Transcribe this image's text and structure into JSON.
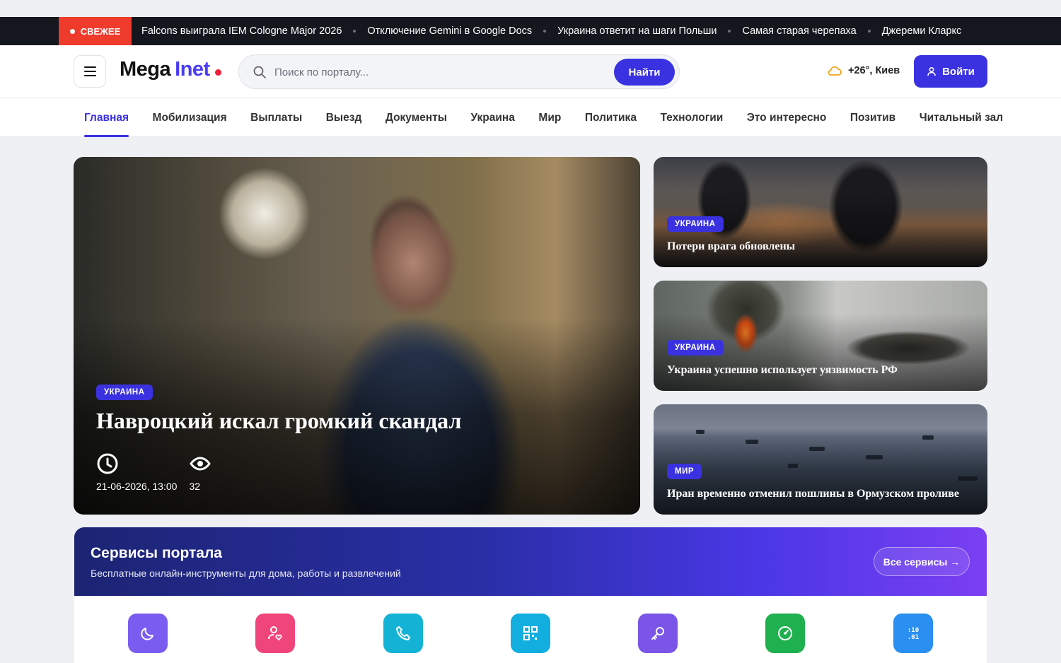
{
  "ticker": {
    "badge": "СВЕЖЕЕ",
    "items": [
      "Falcons выиграла IEM Cologne Major 2026",
      "Отключение Gemini в Google Docs",
      "Украина ответит на шаги Польши",
      "Самая старая черепаха",
      "Джереми Кларкс"
    ]
  },
  "header": {
    "logo_part1": "Mega",
    "logo_part2": "Inet",
    "search_placeholder": "Поиск по порталу...",
    "search_button": "Найти",
    "weather": "+26°, Киев",
    "login": "Войти"
  },
  "nav": [
    "Главная",
    "Мобилизация",
    "Выплаты",
    "Выезд",
    "Документы",
    "Украина",
    "Мир",
    "Политика",
    "Технологии",
    "Это интересно",
    "Позитив",
    "Читальный зал"
  ],
  "hero": {
    "tag": "УКРАИНА",
    "title": "Навроцкий искал громкий скандал",
    "date": "21-06-2026, 13:00",
    "views": "32"
  },
  "side_news": [
    {
      "tag": "УКРАИНА",
      "title": "Потери врага обновлены"
    },
    {
      "tag": "УКРАИНА",
      "title": "Украина успешно использует уязвимость РФ"
    },
    {
      "tag": "МИР",
      "title": "Иран временно отменил пошлины в Ормузском проливе"
    }
  ],
  "services": {
    "title": "Сервисы портала",
    "subtitle": "Бесплатные онлайн-инструменты для дома, работы и развлечений",
    "all_button": "Все сервисы →",
    "icons": [
      {
        "name": "moon-icon",
        "color": "#7b5cf0"
      },
      {
        "name": "user-heart-icon",
        "color": "#f0457a"
      },
      {
        "name": "phone-icon",
        "color": "#14b3d6"
      },
      {
        "name": "qr-code-icon",
        "color": "#12aee0"
      },
      {
        "name": "key-icon",
        "color": "#7a55e8"
      },
      {
        "name": "speedometer-icon",
        "color": "#1fb04f"
      },
      {
        "name": "timer-icon",
        "color": "#2a8ff0"
      }
    ]
  }
}
